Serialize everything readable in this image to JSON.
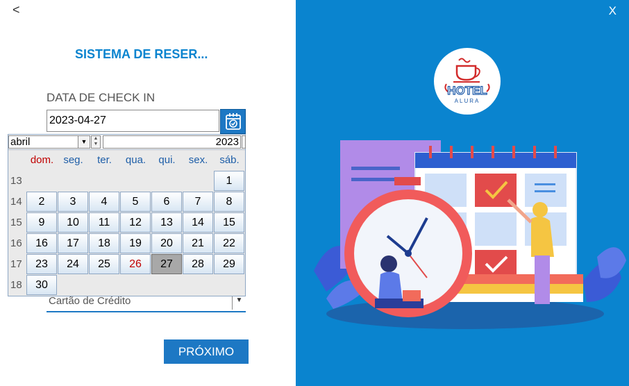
{
  "window": {
    "back_label": "<",
    "close_label": "X"
  },
  "form": {
    "title": "SISTEMA DE RESER...",
    "checkin_label": "DATA DE CHECK IN",
    "checkin_value": "2023-04-27",
    "payment_value": "Cartão de Crédito",
    "next_label": "PRÓXIMO"
  },
  "calendar": {
    "month": "abril",
    "year": "2023",
    "weekdays": [
      "dom.",
      "seg.",
      "ter.",
      "qua.",
      "qui.",
      "sex.",
      "sáb."
    ],
    "week_numbers": [
      "13",
      "14",
      "15",
      "16",
      "17",
      "18"
    ],
    "days": [
      "1",
      "2",
      "3",
      "4",
      "5",
      "6",
      "7",
      "8",
      "9",
      "10",
      "11",
      "12",
      "13",
      "14",
      "15",
      "16",
      "17",
      "18",
      "19",
      "20",
      "21",
      "22",
      "23",
      "24",
      "25",
      "26",
      "27",
      "28",
      "29",
      "30"
    ],
    "selected_day": "27"
  },
  "logo": {
    "top_text": "HOTEL",
    "bottom_text": "ALURA"
  },
  "colors": {
    "accent": "#1d78c4",
    "right_panel": "#0a84cf",
    "sunday": "#c00000",
    "selected_day": "#a8a8a8"
  }
}
